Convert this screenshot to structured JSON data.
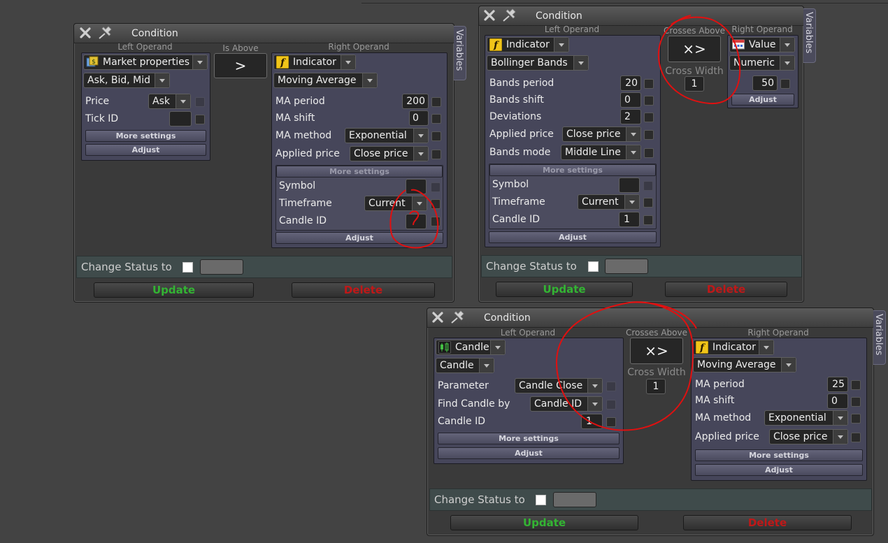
{
  "windows": [
    {
      "title": "Condition",
      "left_label": "Left Operand",
      "op_label": "Is Above",
      "op_symbol": ">",
      "right_label": "Right Operand",
      "vtab": "Variables",
      "left": {
        "type": "Market properties",
        "sub": "Ask, Bid, Mid",
        "rows": [
          {
            "label": "Price",
            "value": "Ask"
          },
          {
            "label": "Tick ID",
            "value": ""
          }
        ],
        "more": "More settings",
        "adjust": "Adjust"
      },
      "right": {
        "type": "Indicator",
        "sub": "Moving Average",
        "rows": [
          {
            "label": "MA period",
            "value": "200"
          },
          {
            "label": "MA shift",
            "value": "0"
          },
          {
            "label": "MA method",
            "value": "Exponential"
          },
          {
            "label": "Applied price",
            "value": "Close price"
          }
        ],
        "more": "More settings",
        "more_rows": [
          {
            "label": "Symbol",
            "value": ""
          },
          {
            "label": "Timeframe",
            "value": "Current"
          },
          {
            "label": "Candle ID",
            "value": ""
          }
        ],
        "adjust": "Adjust"
      },
      "status_label": "Change Status to",
      "update": "Update",
      "delete": "Delete"
    },
    {
      "title": "Condition",
      "left_label": "Left Operand",
      "op_label": "Crosses Above",
      "op_symbol": "×>",
      "cross_label": "Cross Width",
      "cross_value": "1",
      "right_label": "Right Operand",
      "vtab": "Variables",
      "left": {
        "type": "Indicator",
        "sub": "Bollinger Bands",
        "rows": [
          {
            "label": "Bands period",
            "value": "20"
          },
          {
            "label": "Bands shift",
            "value": "0"
          },
          {
            "label": "Deviations",
            "value": "2"
          },
          {
            "label": "Applied price",
            "value": "Close price"
          },
          {
            "label": "Bands mode",
            "value": "Middle Line"
          }
        ],
        "more": "More settings",
        "more_rows": [
          {
            "label": "Symbol",
            "value": ""
          },
          {
            "label": "Timeframe",
            "value": "Current"
          },
          {
            "label": "Candle ID",
            "value": "1"
          }
        ],
        "adjust": "Adjust"
      },
      "right": {
        "type": "Value",
        "sub": "Numeric",
        "value": "50",
        "adjust": "Adjust"
      },
      "status_label": "Change Status to",
      "update": "Update",
      "delete": "Delete"
    },
    {
      "title": "Condition",
      "left_label": "Left Operand",
      "op_label": "Crosses Above",
      "op_symbol": "×>",
      "cross_label": "Cross Width",
      "cross_value": "1",
      "right_label": "Right Operand",
      "vtab": "Variables",
      "left": {
        "type": "Candle",
        "sub": "Candle",
        "rows": [
          {
            "label": "Parameter",
            "value": "Candle Close"
          },
          {
            "label": "Find Candle by",
            "value": "Candle ID"
          },
          {
            "label": "Candle ID",
            "value": "1"
          }
        ],
        "more": "More settings",
        "adjust": "Adjust"
      },
      "right": {
        "type": "Indicator",
        "sub": "Moving Average",
        "rows": [
          {
            "label": "MA period",
            "value": "25"
          },
          {
            "label": "MA shift",
            "value": "0"
          },
          {
            "label": "MA method",
            "value": "Exponential"
          },
          {
            "label": "Applied price",
            "value": "Close price"
          }
        ],
        "more": "More settings",
        "adjust": "Adjust"
      },
      "status_label": "Change Status to",
      "update": "Update",
      "delete": "Delete"
    }
  ],
  "icons": {
    "close": "close-icon",
    "pin": "pin-icon",
    "market": "market-properties-icon",
    "indicator": "indicator-f-icon",
    "value": "value-icon",
    "candle": "candle-icon"
  },
  "colors": {
    "update": "#33b433",
    "delete": "#c01818",
    "annotation": "#e01010",
    "panel": "#46465a"
  }
}
